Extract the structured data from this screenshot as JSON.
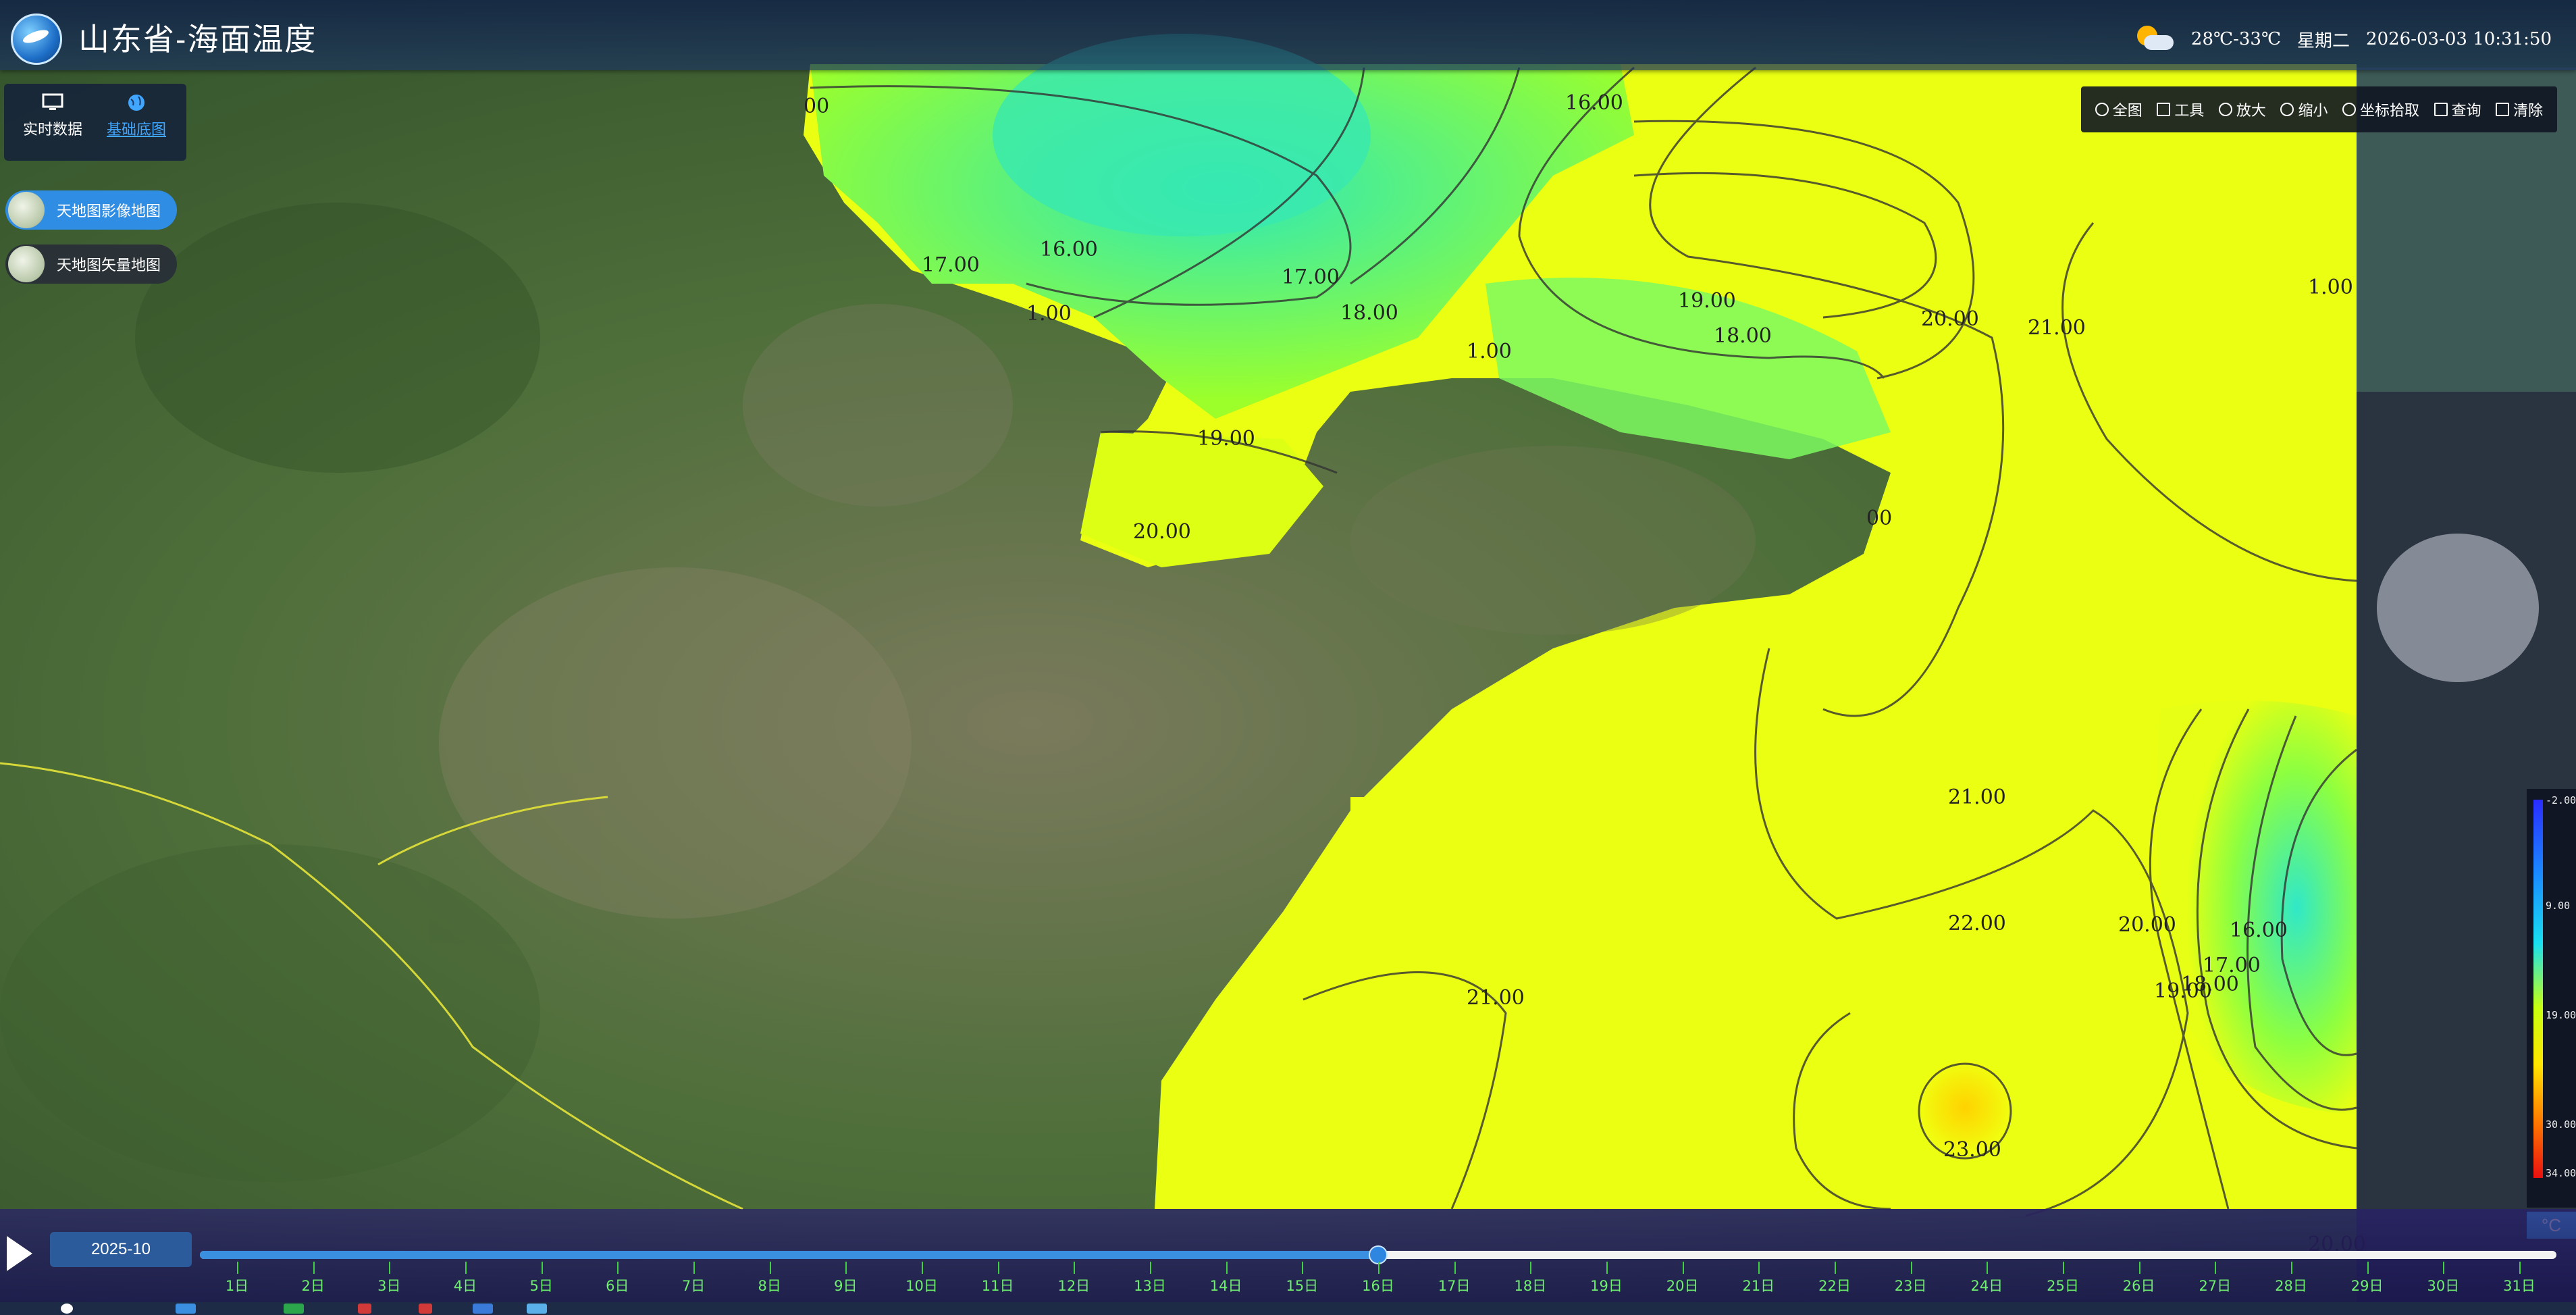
{
  "header": {
    "title": "山东省-海面温度",
    "temperature": "28℃-33℃",
    "weekday": "星期二",
    "datetime": "2026-03-03 10:31:50"
  },
  "layer_panel": {
    "realtime_label": "实时数据",
    "basemap_label": "基础底图",
    "basemaps": [
      "天地图影像地图",
      "天地图矢量地图"
    ]
  },
  "toolbar": {
    "items": [
      "全图",
      "工具",
      "放大",
      "缩小",
      "坐标拾取",
      "查询",
      "清除"
    ]
  },
  "legend": {
    "labels": [
      "-2.00",
      "9.00",
      "19.00",
      "30.00",
      "34.00"
    ],
    "unit": "°C",
    "colors": [
      "#2a2cff",
      "#1a8cff",
      "#19e0f0",
      "#c8ff10",
      "#ffe600",
      "#ff7a00",
      "#e81010"
    ]
  },
  "map": {
    "contour_labels": [
      "00",
      "17.00",
      "16.00",
      "1.00",
      "17.00",
      "18.00",
      "16.00",
      "19.00",
      "1.00",
      "18.00",
      "20.00",
      "21.00",
      "1.00",
      "19.00",
      "20.00",
      "00",
      "21.00",
      "22.00",
      "20.00",
      "16.00",
      "17.00",
      "18.00",
      "19.00",
      "21.00",
      "23.00",
      "20.00"
    ],
    "ocean_color_warm": "#e8ff10",
    "ocean_color_cool": "#3ce8b0"
  },
  "timeline": {
    "month": "2025-10",
    "days": [
      "1日",
      "2日",
      "3日",
      "4日",
      "5日",
      "6日",
      "7日",
      "8日",
      "9日",
      "10日",
      "11日",
      "12日",
      "13日",
      "14日",
      "15日",
      "16日",
      "17日",
      "18日",
      "19日",
      "20日",
      "21日",
      "22日",
      "23日",
      "24日",
      "25日",
      "26日",
      "27日",
      "28日",
      "29日",
      "30日",
      "31日"
    ],
    "progress": 0.5
  }
}
